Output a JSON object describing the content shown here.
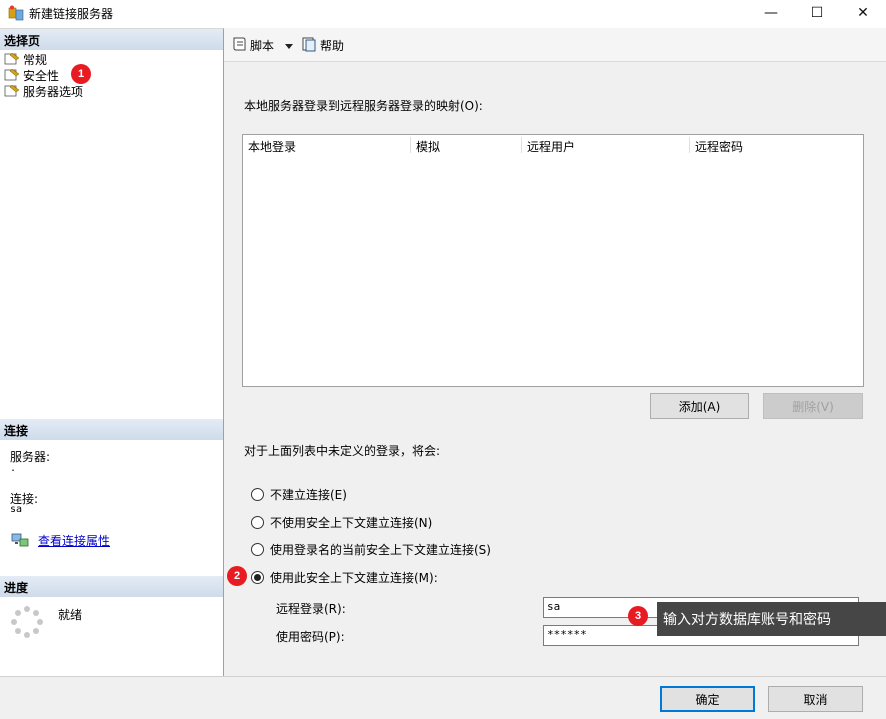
{
  "window": {
    "title": "新建链接服务器",
    "minimize_glyph": "—",
    "maximize_glyph": "☐",
    "close_glyph": "✕"
  },
  "left": {
    "select_page_header": "选择页",
    "pages": [
      {
        "label": "常规",
        "icon": "page-icon"
      },
      {
        "label": "安全性",
        "icon": "page-icon"
      },
      {
        "label": "服务器选项",
        "icon": "page-icon"
      }
    ],
    "connection_header": "连接",
    "server_label": "服务器:",
    "server_value": ".",
    "connection_label": "连接:",
    "connection_value": "sa",
    "view_properties_link": "查看连接属性",
    "progress_header": "进度",
    "progress_status": "就绪"
  },
  "toolbar": {
    "script_label": "脚本",
    "help_label": "帮助"
  },
  "main": {
    "mapping_label": "本地服务器登录到远程服务器登录的映射(O):",
    "columns": [
      "本地登录",
      "模拟",
      "远程用户",
      "远程密码"
    ],
    "add_button": "添加(A)",
    "remove_button": "删除(V)",
    "undefined_login_label": "对于上面列表中未定义的登录，将会:",
    "options": [
      {
        "label": "不建立连接(E)",
        "selected": false
      },
      {
        "label": "不使用安全上下文建立连接(N)",
        "selected": false
      },
      {
        "label": "使用登录名的当前安全上下文建立连接(S)",
        "selected": false
      },
      {
        "label": "使用此安全上下文建立连接(M):",
        "selected": true
      }
    ],
    "remote_login_label": "远程登录(R):",
    "remote_login_value": "sa",
    "password_label": "使用密码(P):",
    "password_value": "******"
  },
  "annotations": {
    "badge_1": "1",
    "badge_2": "2",
    "badge_3": "3",
    "tooltip": "输入对方数据库账号和密码"
  },
  "footer": {
    "ok_button": "确定",
    "cancel_button": "取消"
  },
  "colors": {
    "badge": "#e81b23",
    "header_gradient_top": "#e4ecf5",
    "header_gradient_bottom": "#cfdbea",
    "primary_border": "#0078d7",
    "link": "#0000cc",
    "tooltip_bg": "#464646"
  }
}
